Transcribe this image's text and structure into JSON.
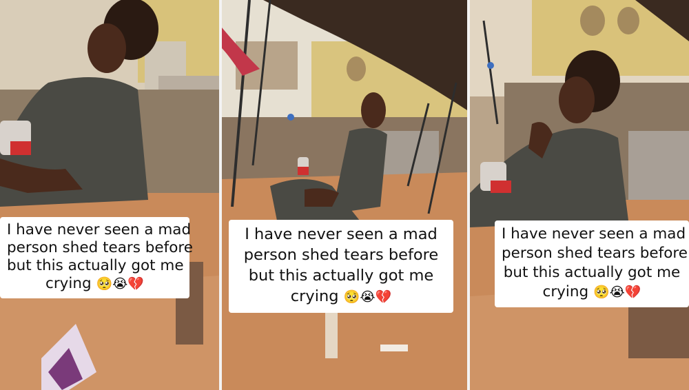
{
  "panels": [
    {
      "caption": {
        "line1": "I have never seen a mad",
        "line2": "person shed tears before",
        "line3": "but this actually got me",
        "line4": "crying",
        "emojis": "🥺😭💔"
      }
    },
    {
      "caption": {
        "line1": "I have never seen a mad",
        "line2": "person shed tears before",
        "line3": "but this actually got me",
        "line4": "crying",
        "emojis": "🥺😭💔"
      }
    },
    {
      "caption": {
        "line1": "I have never seen a mad",
        "line2": "person shed tears before",
        "line3": "but this actually got me",
        "line4": "crying",
        "emojis": "🥺😭💔"
      }
    }
  ],
  "colors": {
    "ground": "#c98a5a",
    "wall": "#b9a48a",
    "sky": "#e8e2d6",
    "shirt": "#4a4a44",
    "skin": "#4a2a1c",
    "roof": "#3a2a20",
    "divider": "#f3f3f3"
  }
}
